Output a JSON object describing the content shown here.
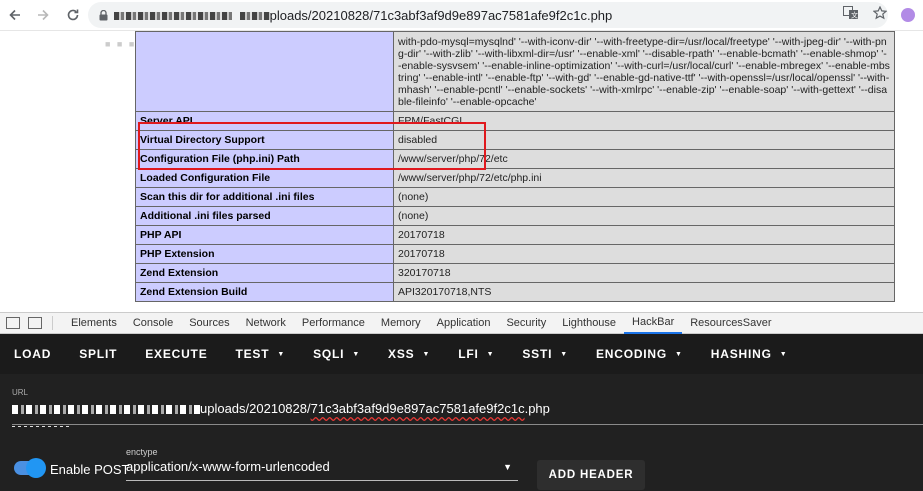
{
  "browser": {
    "url_tail": "ploads/20210828/71c3abf3af9d9e897ac7581afe9f2c1c.php",
    "icons": [
      "back-icon",
      "forward-icon",
      "reload-icon",
      "lock-icon",
      "translate-icon",
      "star-icon",
      "profile-icon"
    ]
  },
  "phpinfo": {
    "configure_text": "with-pdo-mysql=mysqlnd' '--with-iconv-dir' '--with-freetype-dir=/usr/local/freetype' '--with-jpeg-dir' '--with-png-dir' '--with-zlib' '--with-libxml-dir=/usr' '--enable-xml' '--disable-rpath' '--enable-bcmath' '--enable-shmop' '--enable-sysvsem' '--enable-inline-optimization' '--with-curl=/usr/local/curl' '--enable-mbregex' '--enable-mbstring' '--enable-intl' '--enable-ftp' '--with-gd' '--enable-gd-native-ttf' '--with-openssl=/usr/local/openssl' '--with-mhash' '--enable-pcntl' '--enable-sockets' '--with-xmlrpc' '--enable-zip' '--enable-soap' '--with-gettext' '--disable-fileinfo' '--enable-opcache'",
    "rows": [
      {
        "key": "Server API",
        "value": "FPM/FastCGI"
      },
      {
        "key": "Virtual Directory Support",
        "value": "disabled"
      },
      {
        "key": "Configuration File (php.ini) Path",
        "value": "/www/server/php/72/etc"
      },
      {
        "key": "Loaded Configuration File",
        "value": "/www/server/php/72/etc/php.ini"
      },
      {
        "key": "Scan this dir for additional .ini files",
        "value": "(none)"
      },
      {
        "key": "Additional .ini files parsed",
        "value": "(none)"
      },
      {
        "key": "PHP API",
        "value": "20170718"
      },
      {
        "key": "PHP Extension",
        "value": "20170718"
      },
      {
        "key": "Zend Extension",
        "value": "320170718"
      },
      {
        "key": "Zend Extension Build",
        "value": "API320170718,NTS"
      }
    ]
  },
  "devtools": {
    "tabs": [
      "Elements",
      "Console",
      "Sources",
      "Network",
      "Performance",
      "Memory",
      "Application",
      "Security",
      "Lighthouse",
      "HackBar",
      "ResourcesSaver"
    ],
    "active_tab": "HackBar"
  },
  "hackbar": {
    "menu": [
      {
        "label": "LOAD",
        "dropdown": false
      },
      {
        "label": "SPLIT",
        "dropdown": false
      },
      {
        "label": "EXECUTE",
        "dropdown": false
      },
      {
        "label": "TEST",
        "dropdown": true
      },
      {
        "label": "SQLI",
        "dropdown": true
      },
      {
        "label": "XSS",
        "dropdown": true
      },
      {
        "label": "LFI",
        "dropdown": true
      },
      {
        "label": "SSTI",
        "dropdown": true
      },
      {
        "label": "ENCODING",
        "dropdown": true
      },
      {
        "label": "HASHING",
        "dropdown": true
      }
    ],
    "url_label": "URL",
    "url_tail_before": "uploads/20210828/",
    "url_tail_hash": "71c3abf3af9d9e897ac7581afe9f2c1c",
    "url_tail_after": ".php",
    "post_label": "Enable POST",
    "post_enabled": true,
    "enctype_label": "enctype",
    "enctype_value": "application/x-www-form-urlencoded",
    "add_header_label": "ADD HEADER",
    "accent_color": "#2196f3"
  }
}
